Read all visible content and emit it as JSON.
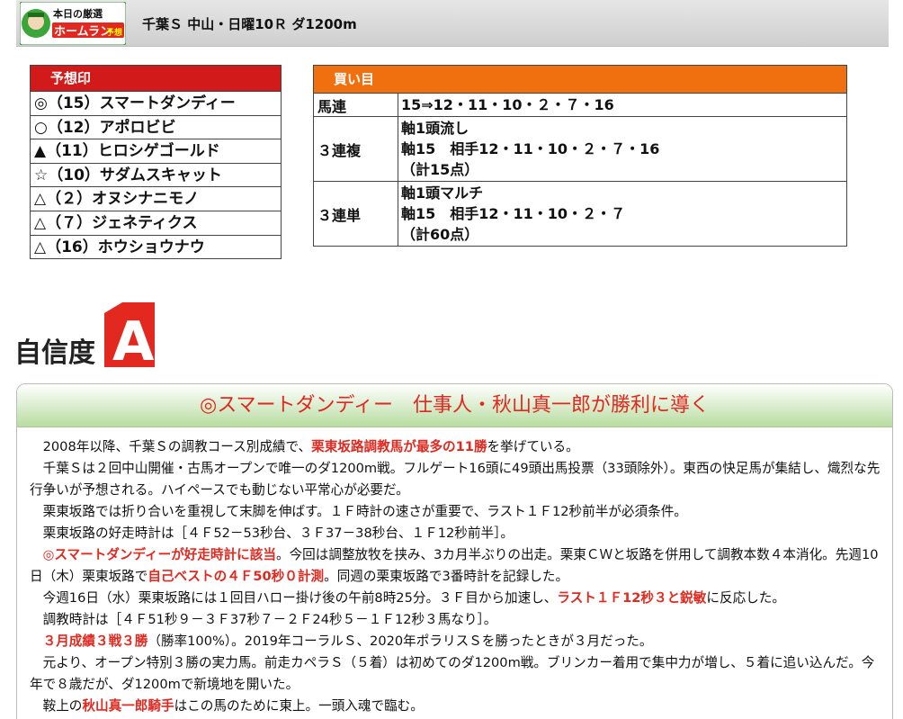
{
  "header": {
    "logo_line1": "本日の厳選",
    "logo_line2": "ホームラン",
    "logo_line3": "予想",
    "race_title": "千葉Ｓ 中山・日曜10Ｒ ダ1200m"
  },
  "marks": {
    "header": "予想印",
    "rows": [
      "◎（15）スマートダンディー",
      "○（12）アポロビビ",
      "▲（11）ヒロシゲゴールド",
      "☆（10）サダムスキャット",
      "△（２）オヌシナニモノ",
      "△（７）ジェネティクス",
      "△（16）ホウショウナウ"
    ]
  },
  "buy": {
    "header": "買い目",
    "rows": [
      {
        "name": "馬連",
        "lines": [
          "15⇒12・11・10・２・７・16"
        ]
      },
      {
        "name": "３連複",
        "lines": [
          "軸1頭流し",
          "軸15　相手12・11・10・２・７・16",
          "（計15点）"
        ]
      },
      {
        "name": "３連単",
        "lines": [
          "軸1頭マルチ",
          "軸15　相手12・11・10・２・７",
          "（計60点）"
        ]
      }
    ]
  },
  "confidence": {
    "label": "自信度",
    "grade": "A"
  },
  "commentary": {
    "title": "◎スマートダンディー　仕事人・秋山真一郎が勝利に導く",
    "paragraphs": [
      [
        {
          "t": "2008年以降、千葉Ｓの調教コース別成績で、"
        },
        {
          "t": "栗東坂路調教馬が最多の11勝",
          "r": true
        },
        {
          "t": "を挙げている。"
        }
      ],
      [
        {
          "t": "千葉Ｓは２回中山開催・古馬オープンで唯一のダ1200m戦。フルゲート16頭に49頭出馬投票（33頭除外）。東西の快足馬が集結し、熾烈な先行争いが予想される。ハイペースでも動じない平常心が必要だ。"
        }
      ],
      [
        {
          "t": "栗東坂路では折り合いを重視して末脚を伸ばす。１Ｆ時計の速さが重要で、ラスト１Ｆ12秒前半が必須条件。"
        }
      ],
      [
        {
          "t": "栗東坂路の好走時計は［４Ｆ52－53秒台、３Ｆ37－38秒台、１Ｆ12秒前半］。"
        }
      ],
      [
        {
          "t": "◎スマートダンディーが好走時計に該当",
          "r": true
        },
        {
          "t": "。今回は調整放牧を挟み、3カ月半ぶりの出走。栗東ＣＷと坂路を併用して調教本数４本消化。先週10日（木）栗東坂路で"
        },
        {
          "t": "自己ベストの４Ｆ50秒０計測",
          "r": true
        },
        {
          "t": "。同週の栗東坂路で3番時計を記録した。"
        }
      ],
      [
        {
          "t": "今週16日（水）栗東坂路には１回目ハロー掛け後の午前8時25分。３Ｆ目から加速し、"
        },
        {
          "t": "ラスト１Ｆ12秒３と鋭敏",
          "r": true
        },
        {
          "t": "に反応した。"
        }
      ],
      [
        {
          "t": "調教時計は［４Ｆ51秒９－３Ｆ37秒７－２Ｆ24秒５－１Ｆ12秒３馬なり］。"
        }
      ],
      [
        {
          "t": "３月成績３戦３勝",
          "r": true
        },
        {
          "t": "（勝率100%）。2019年コーラルＳ、2020年ポラリスＳを勝ったときが３月だった。"
        }
      ],
      [
        {
          "t": "元より、オープン特別３勝の実力馬。前走カペラＳ（５着）は初めてのダ1200m戦。ブリンカー着用で集中力が増し、５着に追い込んだ。今年で８歳だが、ダ1200mで新境地を開いた。"
        }
      ],
      [
        {
          "t": "鞍上の"
        },
        {
          "t": "秋山真一郎騎手",
          "r": true
        },
        {
          "t": "はこの馬のために東上。一頭入魂で臨む。"
        }
      ]
    ]
  },
  "colors": {
    "red_header": "#d21a1a",
    "orange_header": "#f07010",
    "highlight": "#e2281f",
    "title_green": "#b8dda0"
  }
}
